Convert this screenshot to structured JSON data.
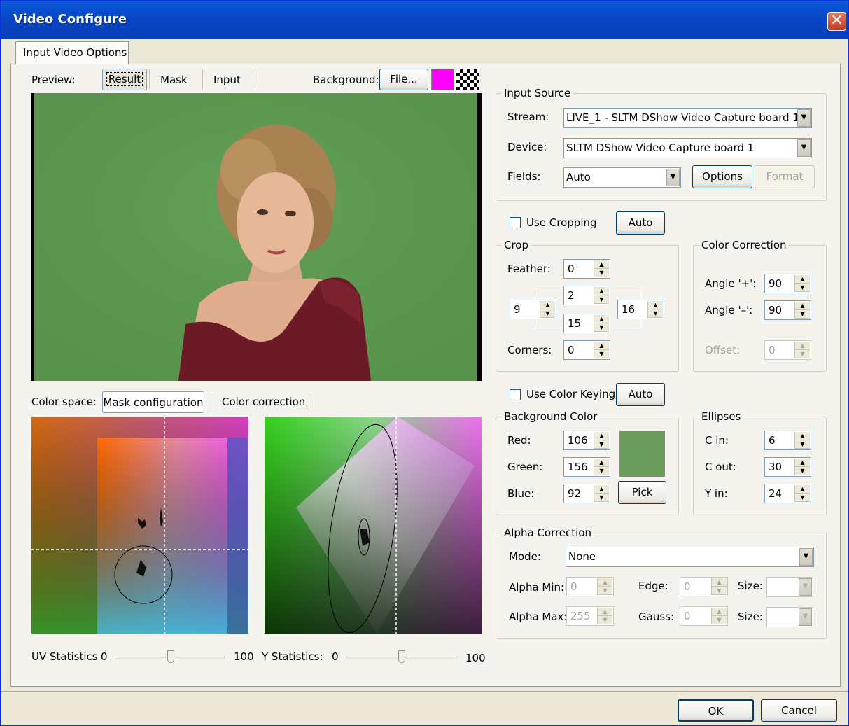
{
  "window": {
    "title": "Video Configure"
  },
  "tabs": {
    "input_video_options": "Input Video Options"
  },
  "preview": {
    "label": "Preview:",
    "result": "Result",
    "mask": "Mask",
    "input": "Input",
    "background_label": "Background:",
    "file_button": "File...",
    "bg_color": "#ff00ff"
  },
  "color_space": {
    "label": "Color space:",
    "mask_configuration": "Mask configuration",
    "color_correction": "Color correction"
  },
  "stats": {
    "uv_label": "UV Statistics",
    "uv_min": "0",
    "uv_max": "100",
    "uv_value": 0.5,
    "y_label": "Y Statistics:",
    "y_min": "0",
    "y_max": "100",
    "y_value": 0.5
  },
  "input_source": {
    "caption": "Input Source",
    "stream_label": "Stream:",
    "stream_value": "LIVE_1 - SLTM DShow  Video Capture board 1",
    "device_label": "Device:",
    "device_value": "SLTM DShow  Video Capture board 1",
    "fields_label": "Fields:",
    "fields_value": "Auto",
    "options_button": "Options",
    "format_button": "Format"
  },
  "cropping": {
    "use_cropping": "Use Cropping",
    "use_cropping_checked": false,
    "auto_button": "Auto",
    "caption": "Crop",
    "feather_label": "Feather:",
    "feather": "0",
    "top": "2",
    "left": "9",
    "right": "16",
    "bottom": "15",
    "corners_label": "Corners:",
    "corners": "0"
  },
  "color_correction": {
    "caption": "Color Correction",
    "angle_plus_label": "Angle '+':",
    "angle_plus": "90",
    "angle_minus_label": "Angle '–':",
    "angle_minus": "90",
    "offset_label": "Offset:",
    "offset": "0"
  },
  "color_keying": {
    "use_color_keying": "Use Color Keying",
    "use_color_keying_checked": false,
    "auto_button": "Auto"
  },
  "background_color": {
    "caption": "Background Color",
    "red_label": "Red:",
    "red": "106",
    "green_label": "Green:",
    "green": "156",
    "blue_label": "Blue:",
    "blue": "92",
    "swatch": "#6a9c5c",
    "pick_button": "Pick"
  },
  "ellipses": {
    "caption": "Ellipses",
    "c_in_label": "C in:",
    "c_in": "6",
    "c_out_label": "C out:",
    "c_out": "30",
    "y_in_label": "Y in:",
    "y_in": "24"
  },
  "alpha_correction": {
    "caption": "Alpha Correction",
    "mode_label": "Mode:",
    "mode_value": "None",
    "alpha_min_label": "Alpha Min:",
    "alpha_min": "0",
    "alpha_max_label": "Alpha Max:",
    "alpha_max": "255",
    "edge_label": "Edge:",
    "edge": "0",
    "gauss_label": "Gauss:",
    "gauss": "0",
    "size_label": "Size:",
    "size2_label": "Size:"
  },
  "footer": {
    "ok": "OK",
    "cancel": "Cancel"
  }
}
